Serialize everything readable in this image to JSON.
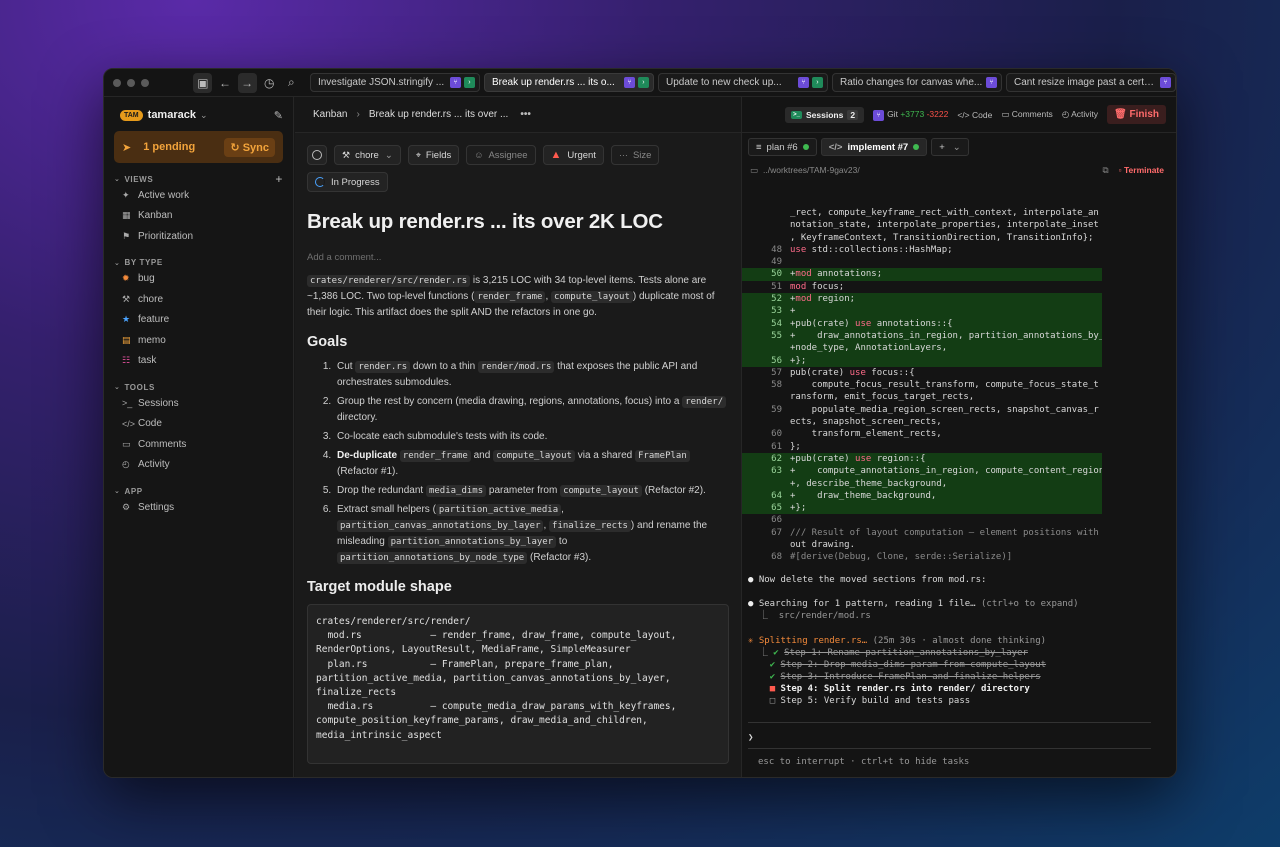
{
  "topbar": {
    "tabs": [
      {
        "label": "Investigate JSON.stringify ...",
        "active": false
      },
      {
        "label": "Break up render.rs ... its o...",
        "active": true
      },
      {
        "label": "Update to new check up...",
        "active": false
      },
      {
        "label": "Ratio changes for canvas whe...",
        "active": false
      },
      {
        "label": "Cant resize image past a certa...",
        "active": false
      }
    ]
  },
  "sidebar": {
    "workspace_badge": "TAM",
    "workspace_name": "tamarack",
    "pending_label": "1 pending",
    "sync_label": "Sync",
    "sections": {
      "views": "VIEWS",
      "by_type": "BY TYPE",
      "tools": "TOOLS",
      "app": "APP"
    },
    "views": [
      "Active work",
      "Kanban",
      "Prioritization"
    ],
    "types": [
      "bug",
      "chore",
      "feature",
      "memo",
      "task"
    ],
    "tools": [
      "Sessions",
      "Code",
      "Comments",
      "Activity"
    ],
    "app": [
      "Settings"
    ]
  },
  "breadcrumb": {
    "root": "Kanban",
    "current": "Break up render.rs ... its over ...",
    "more": "•••"
  },
  "issue": {
    "type_label": "chore",
    "fields_label": "Fields",
    "assignee_label": "Assignee",
    "priority_label": "Urgent",
    "size_label": "Size",
    "status_label": "In Progress",
    "title": "Break up render.rs ... its over 2K LOC",
    "comment_placeholder": "Add a comment...",
    "intro": {
      "code1": "crates/renderer/src/render.rs",
      "t1": " is 3,215 LOC with 34 top-level items. Tests alone are ~1,386 LOC. Two top-level functions (",
      "code2": "render_frame",
      "t2": ", ",
      "code3": "compute_layout",
      "t3": ") duplicate most of their logic. This artifact does the split AND the refactors in one go."
    },
    "goals_heading": "Goals",
    "goals": {
      "g1a": "Cut ",
      "g1c1": "render.rs",
      "g1b": " down to a thin ",
      "g1c2": "render/mod.rs",
      "g1d": " that exposes the public API and orchestrates submodules.",
      "g2a": "Group the rest by concern (media drawing, regions, annotations, focus) into a ",
      "g2c1": "render/",
      "g2b": " directory.",
      "g3": "Co-locate each submodule's tests with its code.",
      "g4b": "De-duplicate",
      "g4a": " ",
      "g4c1": "render_frame",
      "g4m": " and ",
      "g4c2": "compute_layout",
      "g4n": " via a shared ",
      "g4c3": "FramePlan",
      "g4e": " (Refactor #1).",
      "g5a": "Drop the redundant ",
      "g5c1": "media_dims",
      "g5b": " parameter from ",
      "g5c2": "compute_layout",
      "g5e": " (Refactor #2).",
      "g6a": "Extract small helpers (",
      "g6c1": "partition_active_media",
      "g6s1": ", ",
      "g6c2": "partition_canvas_annotations_by_layer",
      "g6s2": ", ",
      "g6c3": "finalize_rects",
      "g6b": ") and rename the misleading ",
      "g6c4": "partition_annotations_by_layer",
      "g6t": " to ",
      "g6c5": "partition_annotations_by_node_type",
      "g6e": " (Refactor #3)."
    },
    "shape_heading": "Target module shape",
    "shape_code": "crates/renderer/src/render/\n  mod.rs            — render_frame, draw_frame, compute_layout, RenderOptions, LayoutResult, MediaFrame, SimpleMeasurer\n  plan.rs           — FramePlan, prepare_frame_plan, partition_active_media, partition_canvas_annotations_by_layer, finalize_rects\n  media.rs          — compute_media_draw_params_with_keyframes, compute_position_keyframe_params, draw_media_and_children, media_intrinsic_aspect"
  },
  "right": {
    "sessions_label": "Sessions",
    "sessions_count": "2",
    "git_label": "Git",
    "git_added": "+3773",
    "git_removed": "-3222",
    "code_label": "Code",
    "comments_label": "Comments",
    "activity_label": "Activity",
    "finish_label": "Finish",
    "term_tabs": [
      {
        "label": "plan #6",
        "active": false
      },
      {
        "label": "implement #7",
        "active": true
      }
    ],
    "path": "../worktrees/TAM-9gav23/",
    "terminate_label": "Terminate",
    "diff_lines": [
      {
        "n": "",
        "t": "_rect, compute_keyframe_rect_with_context, interpolate_an",
        "add": false
      },
      {
        "n": "",
        "t": "notation_state, interpolate_properties, interpolate_inset",
        "add": false
      },
      {
        "n": "",
        "t": ", KeyframeContext, TransitionDirection, TransitionInfo};",
        "add": false
      },
      {
        "n": "48",
        "t": "use std::collections::HashMap;",
        "add": false
      },
      {
        "n": "49",
        "t": "",
        "add": false
      },
      {
        "n": "50",
        "t": "+mod annotations;",
        "add": true
      },
      {
        "n": "51",
        "t": "mod focus;",
        "add": false
      },
      {
        "n": "52",
        "t": "+mod region;",
        "add": true
      },
      {
        "n": "53",
        "t": "+",
        "add": true
      },
      {
        "n": "54",
        "t": "+pub(crate) use annotations::{",
        "add": true
      },
      {
        "n": "55",
        "t": "+    draw_annotations_in_region, partition_annotations_by_",
        "add": true
      },
      {
        "n": "",
        "t": "+node_type, AnnotationLayers,",
        "add": true
      },
      {
        "n": "56",
        "t": "+};",
        "add": true
      },
      {
        "n": "57",
        "t": "pub(crate) use focus::{",
        "add": false
      },
      {
        "n": "58",
        "t": "    compute_focus_result_transform, compute_focus_state_t",
        "add": false
      },
      {
        "n": "",
        "t": "ransform, emit_focus_target_rects,",
        "add": false
      },
      {
        "n": "59",
        "t": "    populate_media_region_screen_rects, snapshot_canvas_r",
        "add": false
      },
      {
        "n": "",
        "t": "ects, snapshot_screen_rects,",
        "add": false
      },
      {
        "n": "60",
        "t": "    transform_element_rects,",
        "add": false
      },
      {
        "n": "61",
        "t": "};",
        "add": false
      },
      {
        "n": "62",
        "t": "+pub(crate) use region::{",
        "add": true
      },
      {
        "n": "63",
        "t": "+    compute_annotations_in_region, compute_content_region",
        "add": true
      },
      {
        "n": "",
        "t": "+, describe_theme_background,",
        "add": true
      },
      {
        "n": "64",
        "t": "+    draw_theme_background,",
        "add": true
      },
      {
        "n": "65",
        "t": "+};",
        "add": true
      },
      {
        "n": "66",
        "t": "",
        "add": false
      },
      {
        "n": "67",
        "t": "/// Result of layout computation — element positions with",
        "add": false
      },
      {
        "n": "",
        "t": "out drawing.",
        "add": false
      },
      {
        "n": "68",
        "t": "#[derive(Debug, Clone, serde::Serialize)]",
        "add": false
      }
    ],
    "log": {
      "delete": "Now delete the moved sections from mod.rs:",
      "search": "Searching for 1 pattern, reading 1 file…",
      "search_hint": " (ctrl+o to expand)",
      "search_path": "src/render/mod.rs",
      "splitting": "Splitting render.rs…",
      "splitting_meta": " (25m 30s · almost done thinking)",
      "step1": "Step 1: Rename partition_annotations_by_layer",
      "step2": "Step 2: Drop media_dims param from compute_layout",
      "step3": "Step 3: Introduce FramePlan and finalize helpers",
      "step4": "Step 4: Split render.rs into render/ directory",
      "step5": "Step 5: Verify build and tests pass",
      "prompt": "❯",
      "hint": "esc to interrupt · ctrl+t to hide tasks"
    }
  },
  "colors": {
    "accent_orange": "#f3a43b",
    "diff_add_bg": "#133d14",
    "urgent_red": "#ff5a4e",
    "git_green": "#3fb950"
  }
}
